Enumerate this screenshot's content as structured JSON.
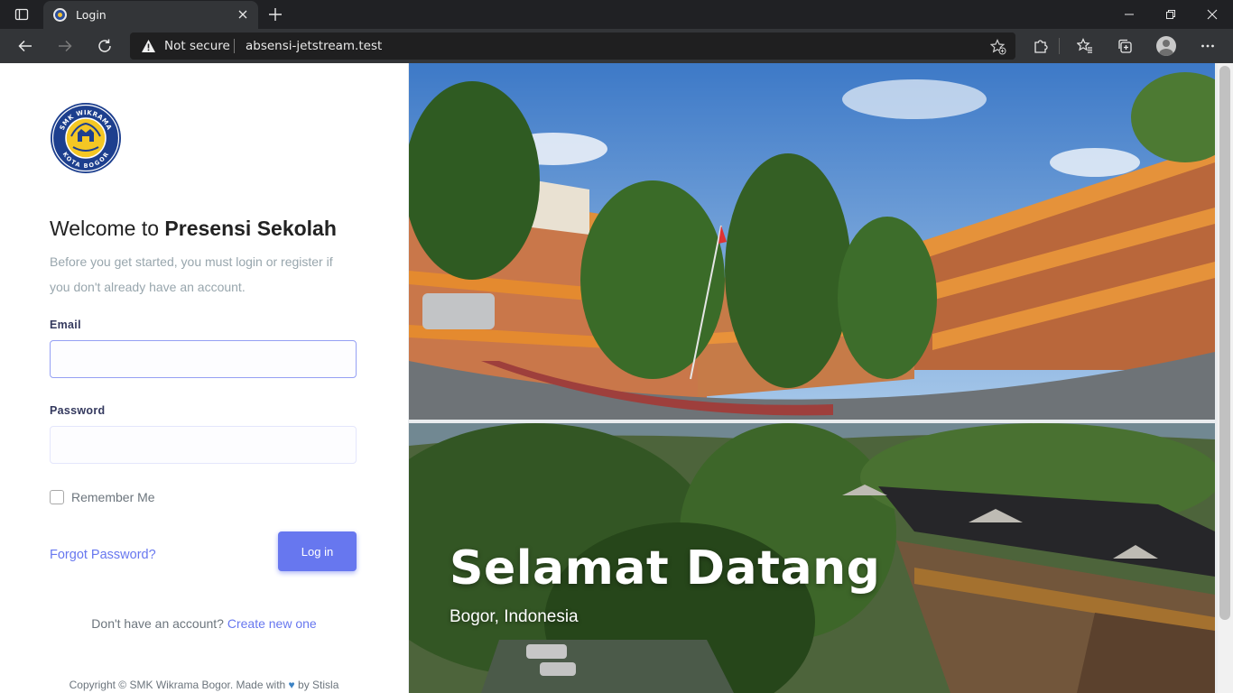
{
  "browser": {
    "tab_title": "Login",
    "security_label": "Not secure",
    "url": "absensi-jetstream.test"
  },
  "logo": {
    "top_text": "SMK WIKRAMA",
    "bottom_text": "KOTA BOGOR"
  },
  "login": {
    "welcome_prefix": "Welcome to ",
    "welcome_brand": "Presensi Sekolah",
    "subtitle": "Before you get started, you must login or register if you don't already have an account.",
    "email_label": "Email",
    "email_value": "",
    "password_label": "Password",
    "password_value": "",
    "remember_label": "Remember Me",
    "forgot_link": "Forgot Password?",
    "login_button": "Log in",
    "signup_prompt": "Don't have an account?",
    "signup_link": "Create new one",
    "copyright_prefix": "Copyright © SMK Wikrama Bogor. Made with",
    "copyright_suffix": "by Stisla",
    "accent_color": "#6777ef"
  },
  "hero": {
    "title": "Selamat Datang",
    "subtitle": "Bogor, Indonesia"
  }
}
